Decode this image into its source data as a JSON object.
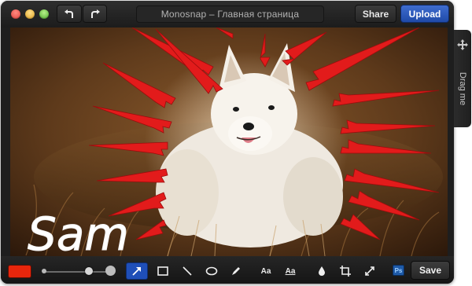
{
  "window": {
    "title": "Monosnap – Главная страница",
    "share_label": "Share",
    "upload_label": "Upload"
  },
  "canvas": {
    "annotation_text": "Sam",
    "arrow_color": "#e21b1b",
    "text_color": "#ffffff"
  },
  "toolbar": {
    "color": "#e8260c",
    "text_tool_label": "Aa",
    "text_bg_tool_label": "Aa",
    "ps_label": "Ps",
    "save_label": "Save",
    "active_tool": "arrow"
  },
  "drag_tab": {
    "label": "Drag me"
  },
  "icons": [
    "undo-icon",
    "redo-icon",
    "arrow-tool-icon",
    "rectangle-icon",
    "line-icon",
    "ellipse-icon",
    "pencil-icon",
    "blur-drop-icon",
    "crop-icon",
    "resize-icon",
    "move-icon"
  ]
}
